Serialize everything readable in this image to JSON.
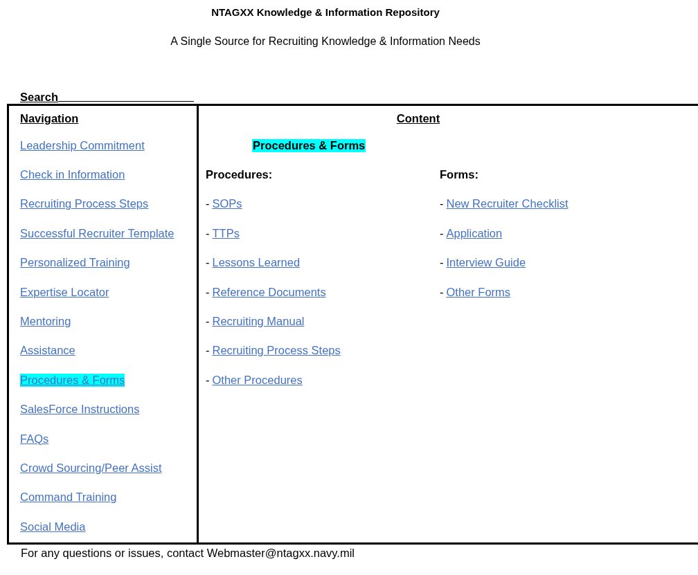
{
  "header": {
    "title": "NTAGXX Knowledge & Information Repository",
    "subtitle": "A Single Source for Recruiting Knowledge & Information Needs"
  },
  "search": {
    "label": "Search"
  },
  "navigation": {
    "heading": "Navigation",
    "items": [
      {
        "label": "Leadership Commitment",
        "selected": false
      },
      {
        "label": "Check in Information",
        "selected": false
      },
      {
        "label": "Recruiting Process Steps",
        "selected": false
      },
      {
        "label": "Successful Recruiter Template",
        "selected": false
      },
      {
        "label": "Personalized Training",
        "selected": false
      },
      {
        "label": "Expertise Locator",
        "selected": false
      },
      {
        "label": "Mentoring",
        "selected": false
      },
      {
        "label": "Assistance",
        "selected": false
      },
      {
        "label": "Procedures & Forms",
        "selected": true
      },
      {
        "label": "SalesForce Instructions",
        "selected": false
      },
      {
        "label": "FAQs",
        "selected": false
      },
      {
        "label": "Crowd Sourcing/Peer Assist",
        "selected": false
      },
      {
        "label": "Command Training",
        "selected": false
      },
      {
        "label": "Social Media",
        "selected": false
      }
    ]
  },
  "content": {
    "heading": "Content",
    "section_title": "Procedures & Forms",
    "columns": [
      {
        "heading": "Procedures:",
        "links": [
          {
            "prefix": "-",
            "label": "SOPs"
          },
          {
            "prefix": "-",
            "label": "TTPs"
          },
          {
            "prefix": "-",
            "label": "Lessons Learned"
          },
          {
            "prefix": "-",
            "label": "Reference Documents"
          },
          {
            "prefix": "-",
            "label": "Recruiting Manual"
          },
          {
            "prefix": "-",
            "label": "Recruiting Process Steps"
          },
          {
            "prefix": "-",
            "label": "Other Procedures"
          }
        ]
      },
      {
        "heading": "Forms:",
        "links": [
          {
            "prefix": "-",
            "label": "New Recruiter Checklist"
          },
          {
            "prefix": "-",
            "label": "Application"
          },
          {
            "prefix": "-",
            "label": "Interview Guide"
          },
          {
            "prefix": "-",
            "label": "Other Forms"
          }
        ]
      }
    ]
  },
  "footer": "For any questions or issues, contact Webmaster@ntagxx.navy.mil"
}
